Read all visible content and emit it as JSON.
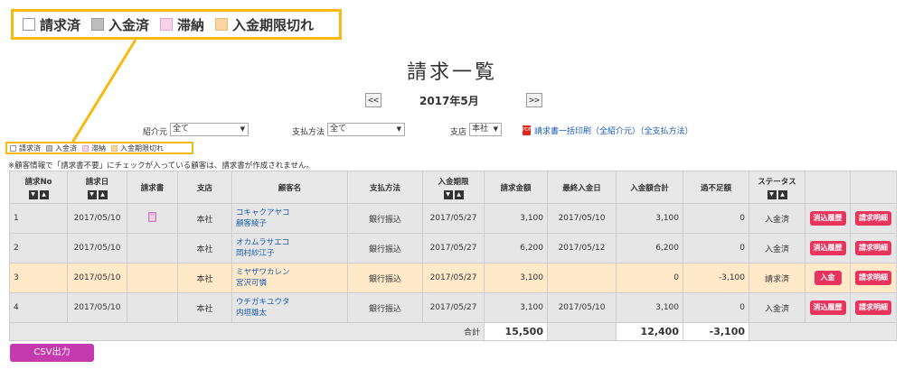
{
  "legend": {
    "items": [
      {
        "label": "請求済",
        "color": "#ffffff",
        "border": "#999999"
      },
      {
        "label": "入金済",
        "color": "#bdbdbd",
        "border": "#999999"
      },
      {
        "label": "滞納",
        "color": "#f9d2ea",
        "border": "#e3a6c9"
      },
      {
        "label": "入金期限切れ",
        "color": "#f9d6a4",
        "border": "#e9b97a"
      }
    ]
  },
  "page": {
    "title": "請求一覧",
    "prev_label": "<<",
    "next_label": ">>",
    "month": "2017年5月",
    "note": "※顧客情報で「請求書不要」にチェックが入っている顧客は、請求書が作成されません。"
  },
  "filters": {
    "introducer_label": "紹介元",
    "introducer_value": "全て",
    "payment_label": "支払方法",
    "payment_value": "全て",
    "branch_label": "支店",
    "branch_value": "本社",
    "print_link": "請求書一括印刷（全紹介元）（全支払方法）"
  },
  "table": {
    "headers": [
      "請求No",
      "請求日",
      "請求書",
      "支店",
      "顧客名",
      "支払方法",
      "入金期限",
      "請求金額",
      "最終入金日",
      "入金額合計",
      "過不足額",
      "ステータス",
      "",
      ""
    ],
    "rows": [
      {
        "no": "1",
        "date": "2017/05/10",
        "has_doc": true,
        "branch": "本社",
        "kana": "コキャクアヤコ",
        "name": "顧客綾子",
        "method": "銀行振込",
        "due": "2017/05/27",
        "amount": "3,100",
        "last_paid": "2017/05/10",
        "paid_total": "3,100",
        "diff": "0",
        "status": "入金済",
        "btn1": "消込履歴",
        "btn2": "請求明細",
        "state": "paid"
      },
      {
        "no": "2",
        "date": "2017/05/10",
        "has_doc": false,
        "branch": "本社",
        "kana": "オカムラサエコ",
        "name": "岡村紗江子",
        "method": "銀行振込",
        "due": "2017/05/27",
        "amount": "6,200",
        "last_paid": "2017/05/12",
        "paid_total": "6,200",
        "diff": "0",
        "status": "入金済",
        "btn1": "消込履歴",
        "btn2": "請求明細",
        "state": "paid"
      },
      {
        "no": "3",
        "date": "2017/05/10",
        "has_doc": false,
        "branch": "本社",
        "kana": "ミヤザワカレン",
        "name": "宮沢可憐",
        "method": "銀行振込",
        "due": "2017/05/27",
        "amount": "3,100",
        "last_paid": "",
        "paid_total": "0",
        "diff": "-3,100",
        "status": "請求済",
        "btn1": "入金",
        "btn2": "請求明細",
        "state": "billed"
      },
      {
        "no": "4",
        "date": "2017/05/10",
        "has_doc": false,
        "branch": "本社",
        "kana": "ウチガキユウタ",
        "name": "内垣雄太",
        "method": "銀行振込",
        "due": "2017/05/27",
        "amount": "3,100",
        "last_paid": "2017/05/10",
        "paid_total": "3,100",
        "diff": "0",
        "status": "入金済",
        "btn1": "消込履歴",
        "btn2": "請求明細",
        "state": "paid"
      }
    ],
    "total_label": "合計",
    "total_amount": "15,500",
    "total_paid": "12,400",
    "total_diff": "-3,100"
  },
  "csv_button": "CSV出力"
}
